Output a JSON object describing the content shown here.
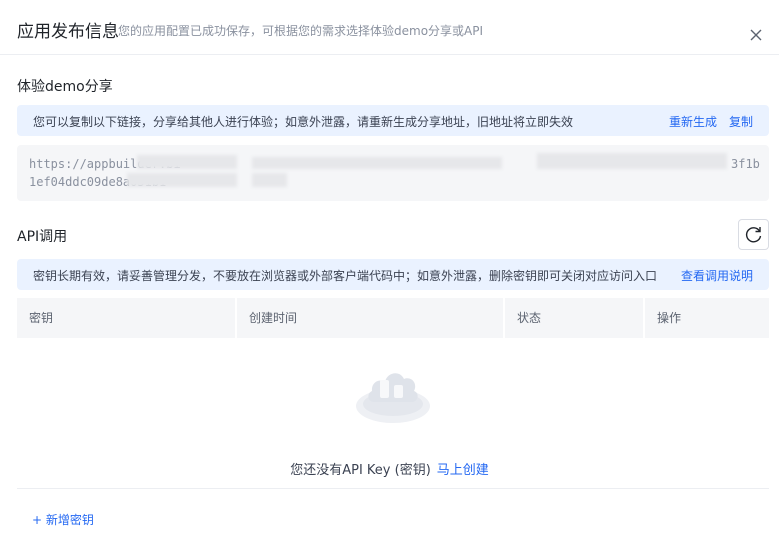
{
  "header": {
    "title": "应用发布信息",
    "subtitle": "您的应用配置已成功保存，可根据您的需求选择体验demo分享或API"
  },
  "demo": {
    "title": "体验demo分享",
    "notice": "您可以复制以下链接，分享给其他人进行体验；如意外泄露，请重新生成分享地址，旧地址将立即失效",
    "regenerate_label": "重新生成",
    "copy_label": "复制",
    "url_line1_start": "https://appbuilder.bi",
    "url_line1_end": "3f1b",
    "url_line2_start": "1ef04ddc09de8a051b1"
  },
  "api": {
    "title": "API调用",
    "notice": "密钥长期有效，请妥善管理分发，不要放在浏览器或外部客户端代码中；如意外泄露，删除密钥即可关闭对应访问入口",
    "docs_label": "查看调用说明",
    "columns": [
      "密钥",
      "创建时间",
      "状态",
      "操作"
    ],
    "empty_text": "您还没有API Key (密钥)",
    "create_now_label": "马上创建",
    "add_key_label": "+ 新增密钥"
  },
  "colors": {
    "accent": "#2468f2",
    "notice_bg": "#eaf2ff",
    "table_head_bg": "#f5f6f8"
  },
  "icons": {
    "close": "close-icon",
    "refresh": "refresh-icon",
    "empty": "empty-cloud-icon"
  }
}
